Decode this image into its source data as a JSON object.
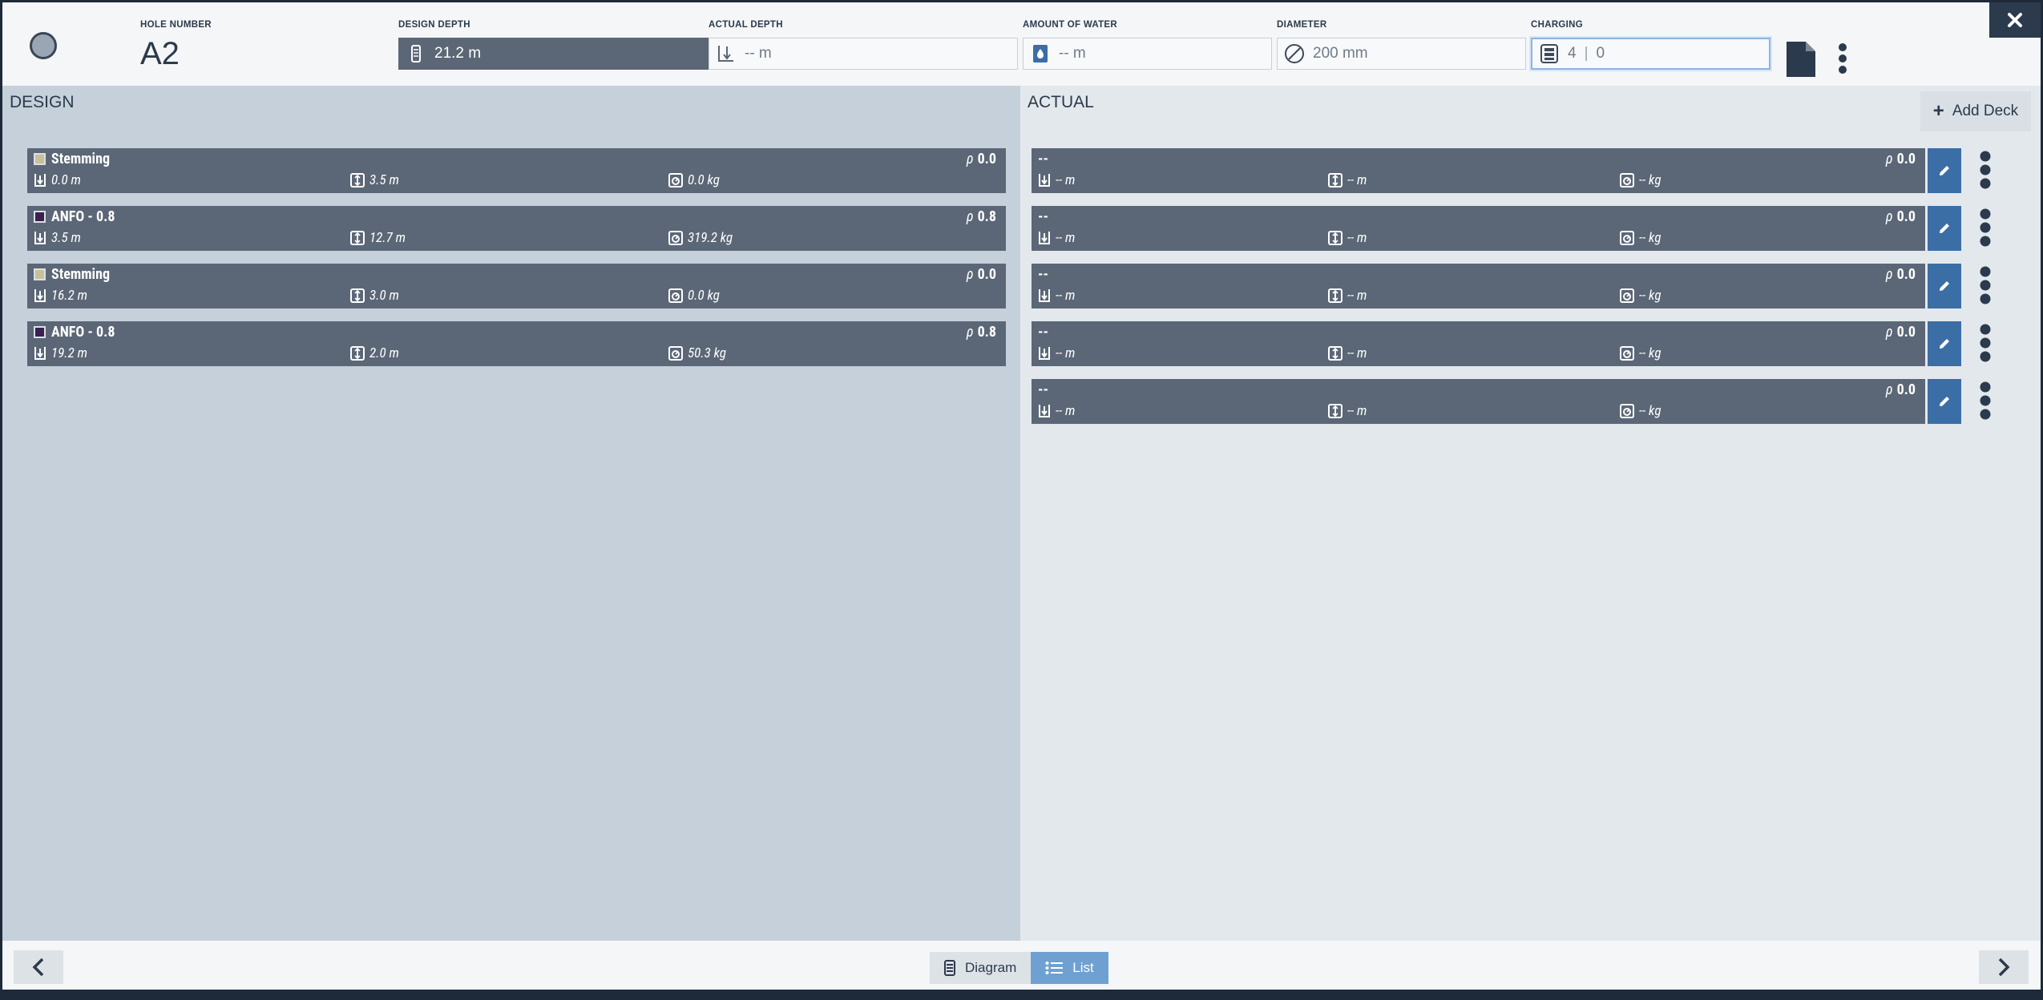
{
  "header": {
    "hole_number_label": "HOLE NUMBER",
    "hole_number": "A2",
    "design_depth_label": "DESIGN DEPTH",
    "design_depth": "21.2 m",
    "actual_depth_label": "ACTUAL DEPTH",
    "actual_depth": "-- m",
    "water_label": "AMOUNT OF WATER",
    "water": "-- m",
    "diameter_label": "DIAMETER",
    "diameter": "200 mm",
    "charging_label": "CHARGING",
    "charging_design": "4",
    "charging_sep": "|",
    "charging_actual": "0"
  },
  "design": {
    "title": "DESIGN",
    "decks": [
      {
        "name": "Stemming",
        "color": "#c9bf9a",
        "rho": "0.0",
        "start": "0.0 m",
        "length": "3.5 m",
        "mass": "0.0 kg"
      },
      {
        "name": "ANFO - 0.8",
        "color": "#3a1f4f",
        "rho": "0.8",
        "start": "3.5 m",
        "length": "12.7 m",
        "mass": "319.2 kg"
      },
      {
        "name": "Stemming",
        "color": "#c9bf9a",
        "rho": "0.0",
        "start": "16.2 m",
        "length": "3.0 m",
        "mass": "0.0 kg"
      },
      {
        "name": "ANFO - 0.8",
        "color": "#3a1f4f",
        "rho": "0.8",
        "start": "19.2 m",
        "length": "2.0 m",
        "mass": "50.3 kg"
      }
    ]
  },
  "actual": {
    "title": "ACTUAL",
    "add_deck_label": "Add Deck",
    "decks": [
      {
        "name": "--",
        "rho": "0.0",
        "start": "-- m",
        "length": "-- m",
        "mass": "-- kg"
      },
      {
        "name": "--",
        "rho": "0.0",
        "start": "-- m",
        "length": "-- m",
        "mass": "-- kg"
      },
      {
        "name": "--",
        "rho": "0.0",
        "start": "-- m",
        "length": "-- m",
        "mass": "-- kg"
      },
      {
        "name": "--",
        "rho": "0.0",
        "start": "-- m",
        "length": "-- m",
        "mass": "-- kg"
      },
      {
        "name": "--",
        "rho": "0.0",
        "start": "-- m",
        "length": "-- m",
        "mass": "-- kg"
      }
    ]
  },
  "footer": {
    "diagram_label": "Diagram",
    "list_label": "List",
    "active_view": "List"
  },
  "icons": {
    "close": "close-icon",
    "document": "document-icon",
    "more": "more-vertical-icon",
    "edit": "pencil-icon",
    "prev": "chevron-left-icon",
    "next": "chevron-right-icon"
  },
  "colors": {
    "deck_bg": "#5b6776",
    "accent_blue": "#3c6ea6",
    "toggle_active": "#6fa0d2",
    "stemming_swatch": "#c9bf9a",
    "anfo_swatch": "#3a1f4f"
  }
}
